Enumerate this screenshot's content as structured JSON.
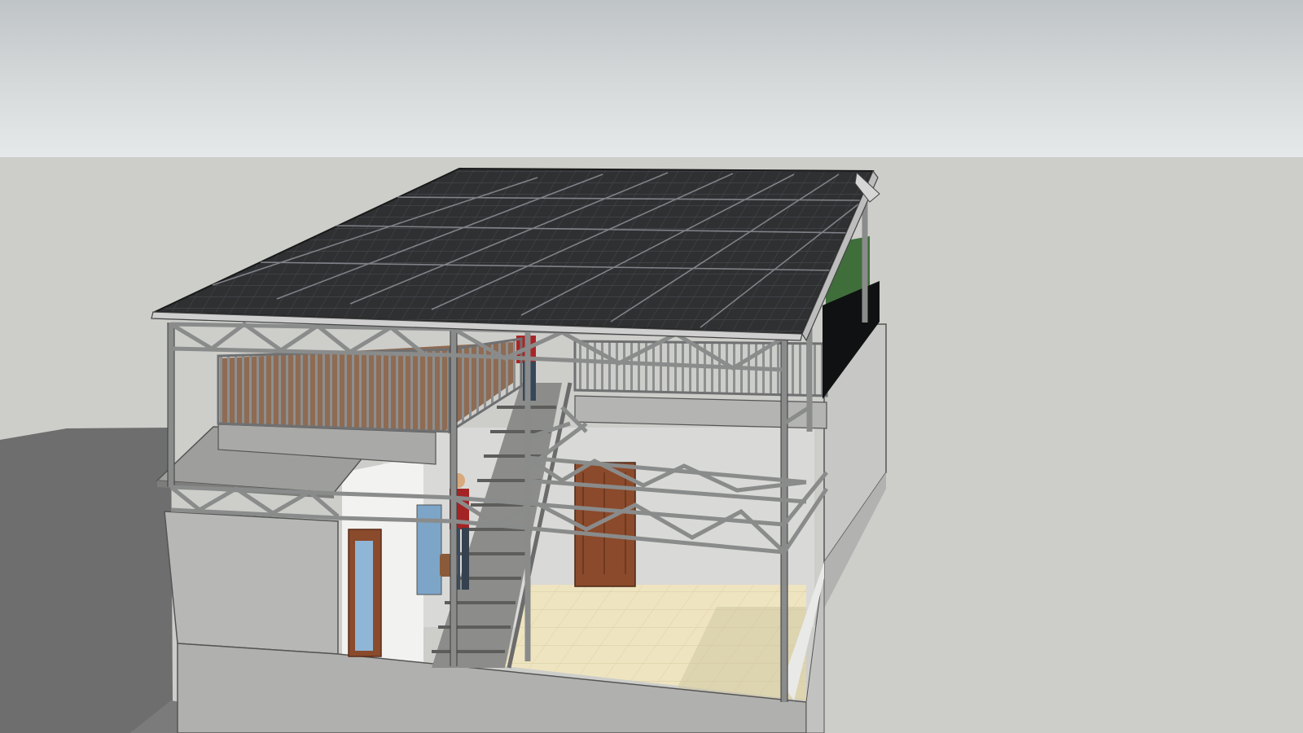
{
  "viewport": {
    "description_none": "",
    "colors": {
      "sky_top": "#bfc4c7",
      "sky_bottom": "#e6e9ea",
      "ground": "#cdcdca",
      "shadow": "#6f6f6f",
      "solar_panel": "#2f3133",
      "frame": "#8b8c8c",
      "concrete": "#b9b9b7",
      "door": "#8a4a2c",
      "floor_tile": "#e9dfb9"
    }
  }
}
